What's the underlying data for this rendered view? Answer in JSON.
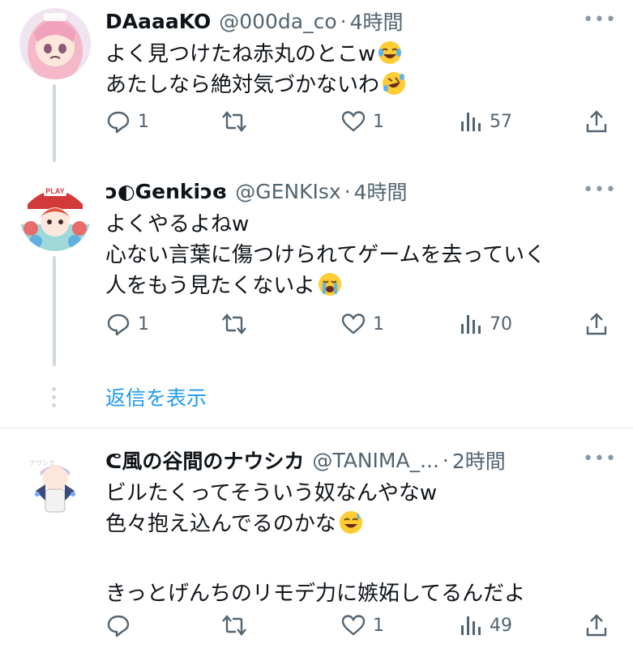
{
  "tweets": [
    {
      "name": "DAaaaKO",
      "handle": "@000da_co",
      "separator": "·",
      "time": "4時間",
      "lines": [
        "よく見つけたね赤丸のとこw",
        "あたしなら絶対気づかないわ"
      ],
      "emojis": [
        "laughing-tears-emoji",
        "rolling-laughing-emoji"
      ],
      "replies": "1",
      "retweets": "",
      "likes": "1",
      "views": "57"
    },
    {
      "name": "ↄ◐Genkiↄɞ",
      "handle": "@GENKIsx",
      "separator": "·",
      "time": "4時間",
      "lines": [
        "よくやるよねw",
        "心ない言葉に傷つけられてゲームを去っていく",
        "人をもう見たくないよ"
      ],
      "emojis": [
        "crying-emoji"
      ],
      "replies": "1",
      "retweets": "",
      "likes": "1",
      "views": "70"
    },
    {
      "name": "ᕦ風の谷間のナウシカ",
      "handle": "@TANIMA_...",
      "separator": "·",
      "time": "2時間",
      "lines": [
        "ビルたくってそういう奴なんやなw",
        "色々抱え込んでるのかな",
        "",
        "きっとげんちのリモデ力に嫉妬してるんだよ"
      ],
      "emojis": [
        "sweat-smile-emoji"
      ],
      "replies": "",
      "retweets": "",
      "likes": "1",
      "views": "49"
    }
  ],
  "show_replies_label": "返信を表示",
  "more_label": "•••",
  "colors": {
    "text": "#0f1419",
    "secondary": "#536471",
    "accent": "#1d9bf0",
    "thread_line": "#cfd9de"
  }
}
